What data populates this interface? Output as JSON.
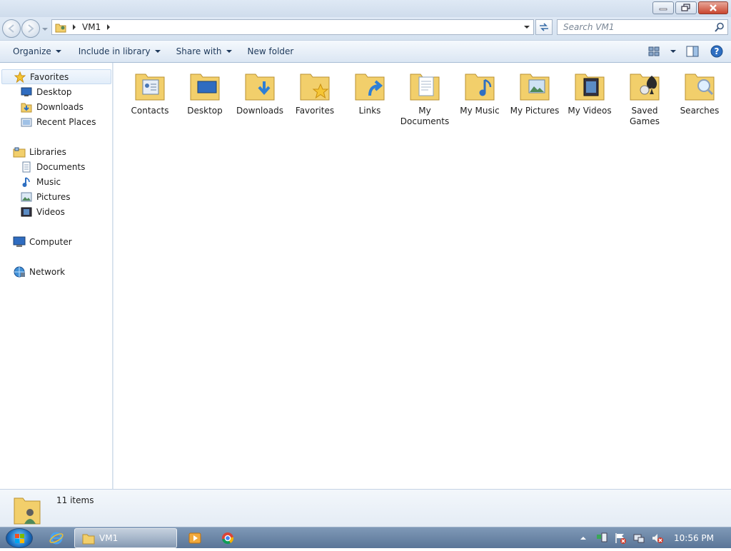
{
  "window": {
    "minimize_icon": "minimize-icon",
    "maximize_icon": "restore-icon",
    "close_icon": "close-icon"
  },
  "address": {
    "crumbs": [
      "VM1"
    ],
    "search_placeholder": "Search VM1"
  },
  "toolbar": {
    "organize": "Organize",
    "include_in_library": "Include in library",
    "share_with": "Share with",
    "new_folder": "New folder"
  },
  "sidebar": {
    "favorites": "Favorites",
    "favorites_items": [
      "Desktop",
      "Downloads",
      "Recent Places"
    ],
    "libraries": "Libraries",
    "libraries_items": [
      "Documents",
      "Music",
      "Pictures",
      "Videos"
    ],
    "computer": "Computer",
    "network": "Network"
  },
  "folders": [
    {
      "label": "Contacts",
      "icon": "contacts-folder-icon"
    },
    {
      "label": "Desktop",
      "icon": "desktop-folder-icon"
    },
    {
      "label": "Downloads",
      "icon": "downloads-folder-icon"
    },
    {
      "label": "Favorites",
      "icon": "favorites-folder-icon"
    },
    {
      "label": "Links",
      "icon": "links-folder-icon"
    },
    {
      "label": "My Documents",
      "icon": "documents-folder-icon"
    },
    {
      "label": "My Music",
      "icon": "music-folder-icon"
    },
    {
      "label": "My Pictures",
      "icon": "pictures-folder-icon"
    },
    {
      "label": "My Videos",
      "icon": "videos-folder-icon"
    },
    {
      "label": "Saved Games",
      "icon": "saved-games-folder-icon"
    },
    {
      "label": "Searches",
      "icon": "searches-folder-icon"
    }
  ],
  "details": {
    "item_count": "11 items"
  },
  "taskbar": {
    "active_window": "VM1",
    "clock": "10:56 PM"
  },
  "colors": {
    "folder": "#f2cf6b",
    "accent": "#1e395b",
    "taskbar": "#6a86a8"
  }
}
